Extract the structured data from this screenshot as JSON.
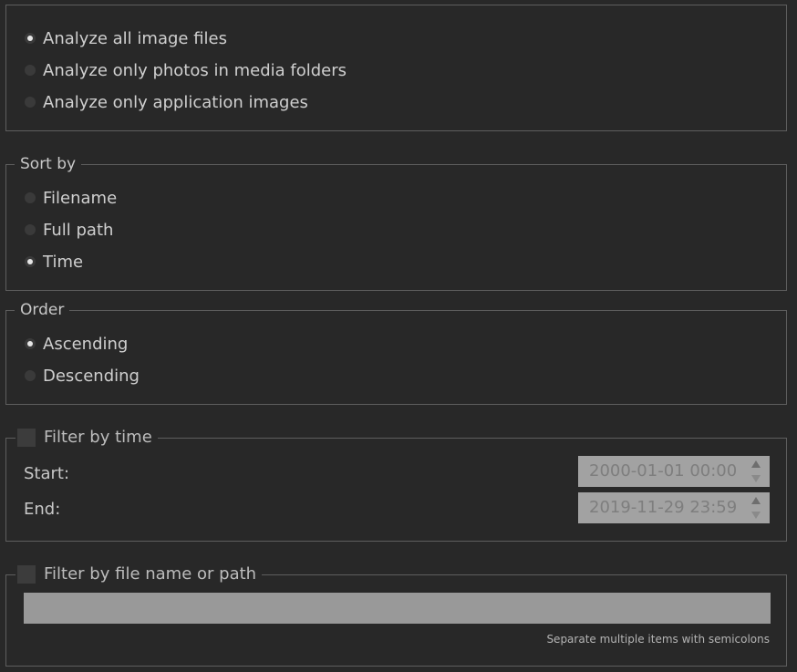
{
  "scope": {
    "options": [
      {
        "label": "Analyze all image files",
        "checked": true
      },
      {
        "label": "Analyze only photos in media folders",
        "checked": false
      },
      {
        "label": "Analyze only application images",
        "checked": false
      }
    ]
  },
  "sort": {
    "title": "Sort by",
    "options": [
      {
        "label": "Filename",
        "checked": false
      },
      {
        "label": "Full path",
        "checked": false
      },
      {
        "label": "Time",
        "checked": true
      }
    ]
  },
  "order": {
    "title": "Order",
    "options": [
      {
        "label": "Ascending",
        "checked": true
      },
      {
        "label": "Descending",
        "checked": false
      }
    ]
  },
  "time_filter": {
    "label": "Filter by time",
    "checked": false,
    "start_label": "Start:",
    "start_value": "2000-01-01 00:00",
    "end_label": "End:",
    "end_value": "2019-11-29 23:59"
  },
  "name_filter": {
    "label": "Filter by file name or path",
    "checked": false,
    "value": "",
    "hint": "Separate multiple items with semicolons"
  }
}
